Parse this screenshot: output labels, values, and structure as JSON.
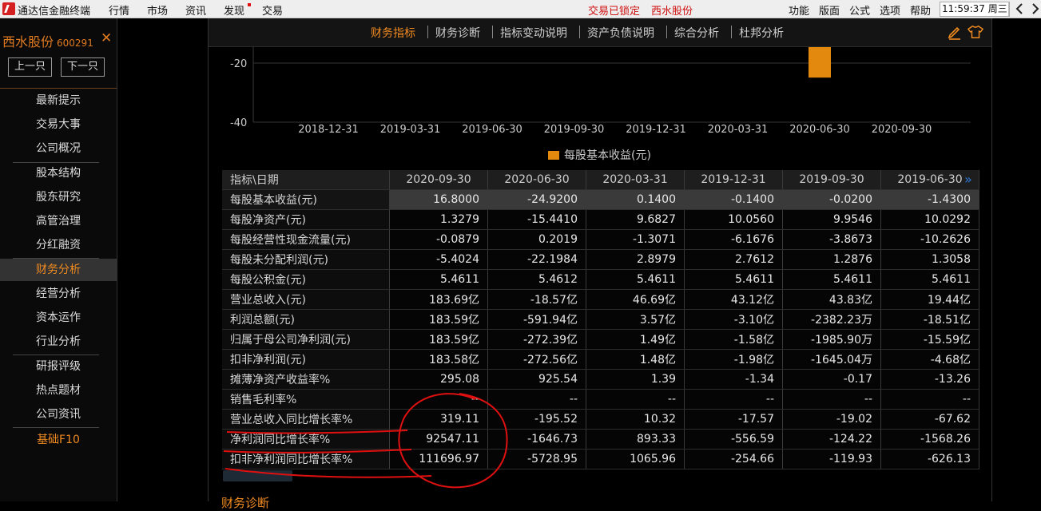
{
  "menubar": {
    "app_name": "通达信金融终端",
    "menus": [
      "行情",
      "市场",
      "资讯",
      "发现",
      "交易"
    ],
    "lock_status": "交易已锁定",
    "stock_name": "西水股份",
    "right_menus": [
      "功能",
      "版面",
      "公式",
      "选项",
      "帮助"
    ],
    "clock": "11:59:37 周三"
  },
  "sidebar": {
    "stock_name": "西水股份",
    "stock_code": "600291",
    "prev_label": "上一只",
    "next_label": "下一只",
    "items": [
      "最新提示",
      "交易大事",
      "公司概况",
      "股本结构",
      "股东研究",
      "高管治理",
      "分红融资",
      "财务分析",
      "经营分析",
      "资本运作",
      "行业分析",
      "研报评级",
      "热点题材",
      "公司资讯",
      "基础F10"
    ],
    "active_item": "财务分析"
  },
  "tabs": [
    "财务指标",
    "财务诊断",
    "指标变动说明",
    "资产负债说明",
    "综合分析",
    "杜邦分析"
  ],
  "chart_data": {
    "type": "bar",
    "categories": [
      "2018-12-31",
      "2019-03-31",
      "2019-06-30",
      "2019-09-30",
      "2019-12-31",
      "2020-03-31",
      "2020-06-30",
      "2020-09-30"
    ],
    "series": [
      {
        "name": "每股基本收益(元)",
        "values": [
          null,
          null,
          null,
          null,
          null,
          null,
          -24.92,
          null
        ]
      }
    ],
    "y_ticks": [
      "-20",
      "-40"
    ],
    "bar_color": "#e38a0e",
    "legend": "bottom-center"
  },
  "table": {
    "header_label": "指标\\日期",
    "columns": [
      "2020-09-30",
      "2020-06-30",
      "2020-03-31",
      "2019-12-31",
      "2019-09-30",
      "2019-06-30"
    ],
    "rows": [
      {
        "label": "每股基本收益(元)",
        "values": [
          "16.8000",
          "-24.9200",
          "0.1400",
          "-0.1400",
          "-0.0200",
          "-1.4300"
        ]
      },
      {
        "label": "每股净资产(元)",
        "values": [
          "1.3279",
          "-15.4410",
          "9.6827",
          "10.0560",
          "9.9546",
          "10.0292"
        ]
      },
      {
        "label": "每股经营性现金流量(元)",
        "values": [
          "-0.0879",
          "0.2019",
          "-1.3071",
          "-6.1676",
          "-3.8673",
          "-10.2626"
        ]
      },
      {
        "label": "每股未分配利润(元)",
        "values": [
          "-5.4024",
          "-22.1984",
          "2.8979",
          "2.7612",
          "1.2876",
          "1.3058"
        ]
      },
      {
        "label": "每股公积金(元)",
        "values": [
          "5.4611",
          "5.4612",
          "5.4611",
          "5.4611",
          "5.4611",
          "5.4611"
        ]
      },
      {
        "label": "营业总收入(元)",
        "values": [
          "183.69亿",
          "-18.57亿",
          "46.69亿",
          "43.12亿",
          "43.83亿",
          "19.44亿"
        ]
      },
      {
        "label": "利润总额(元)",
        "values": [
          "183.59亿",
          "-591.94亿",
          "3.57亿",
          "-3.10亿",
          "-2382.23万",
          "-18.51亿"
        ]
      },
      {
        "label": "归属于母公司净利润(元)",
        "values": [
          "183.59亿",
          "-272.39亿",
          "1.49亿",
          "-1.58亿",
          "-1985.90万",
          "-15.59亿"
        ]
      },
      {
        "label": "扣非净利润(元)",
        "values": [
          "183.58亿",
          "-272.56亿",
          "1.48亿",
          "-1.98亿",
          "-1645.04万",
          "-4.68亿"
        ]
      },
      {
        "label": "摊薄净资产收益率%",
        "values": [
          "295.08",
          "925.54",
          "1.39",
          "-1.34",
          "-0.17",
          "-13.26"
        ]
      },
      {
        "label": "销售毛利率%",
        "values": [
          "--",
          "--",
          "--",
          "--",
          "--",
          "--"
        ]
      },
      {
        "label": "营业总收入同比增长率%",
        "values": [
          "319.11",
          "-195.52",
          "10.32",
          "-17.57",
          "-19.02",
          "-67.62"
        ]
      },
      {
        "label": "净利润同比增长率%",
        "values": [
          "92547.11",
          "-1646.73",
          "893.33",
          "-556.59",
          "-124.22",
          "-1568.26"
        ]
      },
      {
        "label": "扣非净利润同比增长率%",
        "values": [
          "111696.97",
          "-5728.95",
          "1065.96",
          "-254.66",
          "-119.93",
          "-626.13"
        ]
      }
    ]
  },
  "next_section": "财务诊断",
  "colors": {
    "accent": "#f08a20",
    "annotation": "#e01010",
    "link": "#2e78d8"
  }
}
